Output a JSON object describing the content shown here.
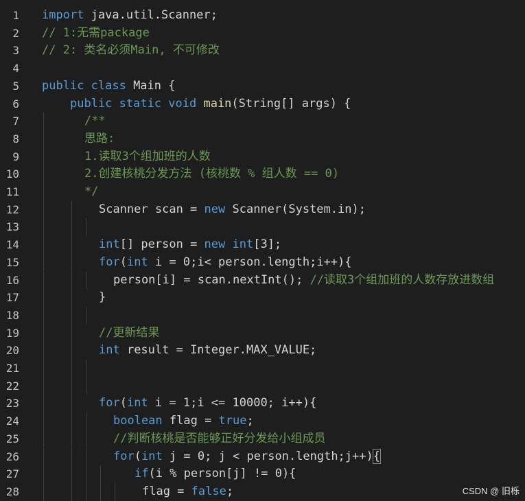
{
  "editor": {
    "lines": [
      {
        "n": "1",
        "i": 0,
        "t": [
          [
            "kw",
            "import"
          ],
          [
            "",
            "java.util.Scanner;"
          ]
        ]
      },
      {
        "n": "2",
        "i": 0,
        "t": [
          [
            "ct",
            "// 1:无需package"
          ]
        ]
      },
      {
        "n": "3",
        "i": 0,
        "t": [
          [
            "ct",
            "// 2: 类名必须Main, 不可修改"
          ]
        ]
      },
      {
        "n": "4",
        "i": 0,
        "t": []
      },
      {
        "n": "5",
        "i": 0,
        "t": [
          [
            "kw",
            "public class"
          ],
          [
            "",
            "Main {"
          ]
        ]
      },
      {
        "n": "6",
        "i": 1,
        "t": [
          [
            "kw",
            "public static void"
          ],
          [
            "fn",
            "main"
          ],
          [
            "",
            "(String[] args) {"
          ]
        ]
      },
      {
        "n": "7",
        "i": 2,
        "t": [
          [
            "ct",
            "/**"
          ]
        ]
      },
      {
        "n": "8",
        "i": 2,
        "t": [
          [
            "ct",
            "思路:"
          ]
        ]
      },
      {
        "n": "9",
        "i": 2,
        "t": [
          [
            "ct",
            "1.读取3个组加班的人数"
          ]
        ]
      },
      {
        "n": "10",
        "i": 2,
        "t": [
          [
            "ct",
            "2.创建核桃分发方法 (核桃数 % 组人数 == 0)"
          ]
        ]
      },
      {
        "n": "11",
        "i": 2,
        "t": [
          [
            "ct",
            "*/"
          ]
        ]
      },
      {
        "n": "12",
        "i": 3,
        "t": [
          [
            "",
            "Scanner scan = "
          ],
          [
            "kw",
            "new"
          ],
          [
            "",
            "Scanner(System.in);"
          ]
        ]
      },
      {
        "n": "13",
        "i": 3,
        "t": []
      },
      {
        "n": "14",
        "i": 3,
        "t": [
          [
            "kw",
            "int"
          ],
          [
            "",
            "[] person = "
          ],
          [
            "kw",
            "new"
          ],
          [
            "kw",
            "int"
          ],
          [
            "",
            "[3];"
          ]
        ]
      },
      {
        "n": "15",
        "i": 3,
        "t": [
          [
            "kw",
            "for"
          ],
          [
            "",
            "("
          ],
          [
            "kw",
            "int"
          ],
          [
            "",
            "i = 0;i< person.length;i++){"
          ]
        ]
      },
      {
        "n": "16",
        "i": 4,
        "t": [
          [
            "",
            "person[i] = scan.nextInt();"
          ],
          [
            "ct",
            "//读取3个组加班的人数存放进数组"
          ]
        ]
      },
      {
        "n": "17",
        "i": 3,
        "t": [
          [
            "",
            "}"
          ]
        ]
      },
      {
        "n": "18",
        "i": 3,
        "t": []
      },
      {
        "n": "19",
        "i": 3,
        "t": [
          [
            "ct",
            "//更新结果"
          ]
        ]
      },
      {
        "n": "20",
        "i": 3,
        "t": [
          [
            "kw",
            "int"
          ],
          [
            "",
            "result = Integer.MAX_VALUE;"
          ]
        ]
      },
      {
        "n": "21",
        "i": 3,
        "t": []
      },
      {
        "n": "22",
        "i": 3,
        "t": []
      },
      {
        "n": "23",
        "i": 3,
        "t": [
          [
            "kw",
            "for"
          ],
          [
            "",
            "("
          ],
          [
            "kw",
            "int"
          ],
          [
            "",
            "i = 1;i <= 10000; i++){"
          ]
        ]
      },
      {
        "n": "24",
        "i": 4,
        "t": [
          [
            "kw",
            "boolean"
          ],
          [
            "",
            "flag = "
          ],
          [
            "kw",
            "true"
          ],
          [
            "",
            ";"
          ]
        ]
      },
      {
        "n": "25",
        "i": 4,
        "t": [
          [
            "ct",
            "//判断核桃是否能够正好分发给小组成员"
          ]
        ]
      },
      {
        "n": "26",
        "i": 4,
        "t": [
          [
            "kw",
            "for"
          ],
          [
            "",
            "("
          ],
          [
            "kw",
            "int"
          ],
          [
            "",
            "j = 0; j < person.length;j++)"
          ],
          [
            "br",
            "{"
          ]
        ]
      },
      {
        "n": "27",
        "i": 5,
        "t": [
          [
            "kw",
            "if"
          ],
          [
            "",
            "(i % person[j] != 0){"
          ]
        ]
      },
      {
        "n": "28",
        "i": 6,
        "t": [
          [
            "",
            "flag = "
          ],
          [
            "kw",
            "false"
          ],
          [
            "",
            ";"
          ]
        ]
      }
    ]
  },
  "watermark": "CSDN @ 旧栎"
}
